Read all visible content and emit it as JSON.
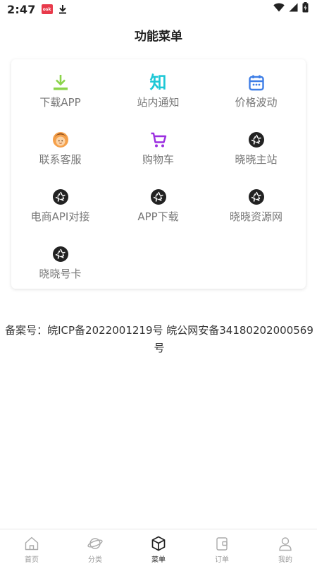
{
  "status_bar": {
    "time": "2:47",
    "notification_badge_text": "osk"
  },
  "header": {
    "title": "功能菜单"
  },
  "menu": {
    "items": [
      {
        "label": "下载APP",
        "icon": "download-icon",
        "color": "#8BD44A"
      },
      {
        "label": "站内通知",
        "icon": "zhi-glyph-icon",
        "glyph": "知",
        "color": "#1EC8D6"
      },
      {
        "label": "价格波动",
        "icon": "calendar-icon",
        "color": "#3E7EE6"
      },
      {
        "label": "联系客服",
        "icon": "customer-service-icon",
        "color": "#F5A04A"
      },
      {
        "label": "购物车",
        "icon": "cart-icon",
        "color": "#9B2FE0"
      },
      {
        "label": "晓晓主站",
        "icon": "aperture-icon",
        "color": "#222222"
      },
      {
        "label": "电商API对接",
        "icon": "aperture-icon",
        "color": "#222222"
      },
      {
        "label": "APP下载",
        "icon": "aperture-icon",
        "color": "#222222"
      },
      {
        "label": "晓晓资源网",
        "icon": "aperture-icon",
        "color": "#222222"
      },
      {
        "label": "晓晓号卡",
        "icon": "aperture-icon",
        "color": "#222222"
      }
    ]
  },
  "footer": {
    "beian_line1": "备案号：皖ICP备2022001219号 皖公网安备34180202000569",
    "beian_line2": "号"
  },
  "tab_bar": {
    "tabs": [
      {
        "label": "首页",
        "icon": "home-icon"
      },
      {
        "label": "分类",
        "icon": "planet-icon"
      },
      {
        "label": "菜单",
        "icon": "cube-icon",
        "active": true
      },
      {
        "label": "订单",
        "icon": "order-icon"
      },
      {
        "label": "我的",
        "icon": "user-icon"
      }
    ]
  }
}
